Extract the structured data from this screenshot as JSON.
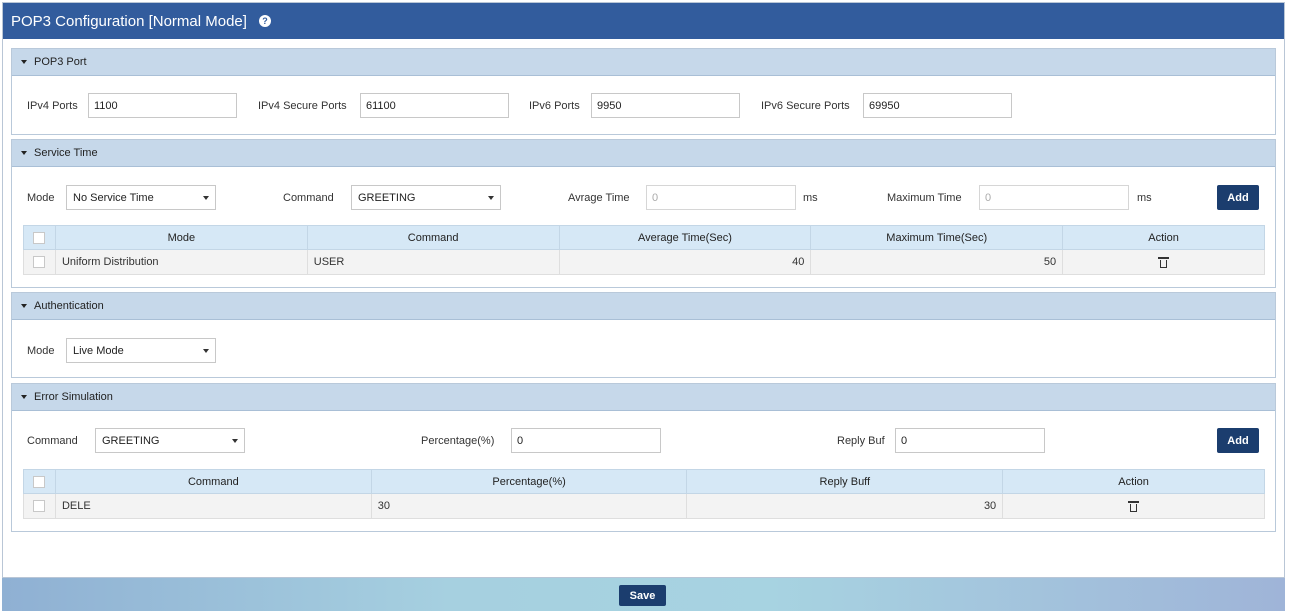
{
  "title": "POP3 Configuration [Normal Mode]",
  "pop3_port": {
    "header": "POP3 Port",
    "ipv4_label": "IPv4 Ports",
    "ipv4_value": "1100",
    "ipv4s_label": "IPv4 Secure Ports",
    "ipv4s_value": "61100",
    "ipv6_label": "IPv6 Ports",
    "ipv6_value": "9950",
    "ipv6s_label": "IPv6 Secure Ports",
    "ipv6s_value": "69950"
  },
  "service_time": {
    "header": "Service Time",
    "mode_label": "Mode",
    "mode_value": "No Service Time",
    "command_label": "Command",
    "command_value": "GREETING",
    "avg_label": "Avrage Time",
    "avg_value": "0",
    "avg_unit": "ms",
    "max_label": "Maximum Time",
    "max_value": "0",
    "max_unit": "ms",
    "add_label": "Add",
    "columns": [
      "Mode",
      "Command",
      "Average Time(Sec)",
      "Maximum Time(Sec)",
      "Action"
    ],
    "rows": [
      {
        "mode": "Uniform Distribution",
        "command": "USER",
        "avg": "40",
        "max": "50"
      }
    ]
  },
  "authentication": {
    "header": "Authentication",
    "mode_label": "Mode",
    "mode_value": "Live Mode"
  },
  "error_simulation": {
    "header": "Error Simulation",
    "command_label": "Command",
    "command_value": "GREETING",
    "percentage_label": "Percentage(%)",
    "percentage_value": "0",
    "reply_label": "Reply Buf",
    "reply_value": "0",
    "add_label": "Add",
    "columns": [
      "Command",
      "Percentage(%)",
      "Reply Buff",
      "Action"
    ],
    "rows": [
      {
        "command": "DELE",
        "percentage": "30",
        "reply": "30"
      }
    ]
  },
  "save_label": "Save"
}
